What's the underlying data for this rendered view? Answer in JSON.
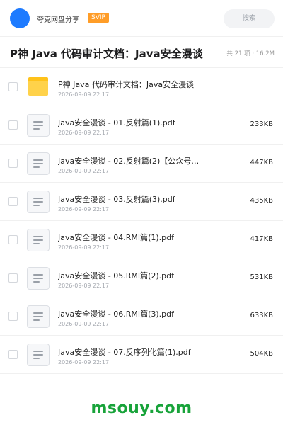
{
  "header": {
    "user_name": "夸克网盘分享",
    "badge": "SVIP",
    "search_placeholder": "搜索"
  },
  "folder": {
    "title": "P神 Java 代码审计文档：Java安全漫谈",
    "meta": "共 21 项 · 16.2M"
  },
  "items": [
    {
      "type": "folder",
      "name": "P神 Java 代码审计文档：Java安全漫谈",
      "date": "2026-09-09 22:17",
      "size": ""
    },
    {
      "type": "file",
      "name": "Java安全漫谈 - 01.反射篇(1).pdf",
      "date": "2026-09-09 22:17",
      "size": "233KB"
    },
    {
      "type": "file",
      "name": "Java安全漫谈 - 02.反射篇(2)【公众号：…",
      "date": "2026-09-09 22:17",
      "size": "447KB"
    },
    {
      "type": "file",
      "name": "Java安全漫谈 - 03.反射篇(3).pdf",
      "date": "2026-09-09 22:17",
      "size": "435KB"
    },
    {
      "type": "file",
      "name": "Java安全漫谈 - 04.RMI篇(1).pdf",
      "date": "2026-09-09 22:17",
      "size": "417KB"
    },
    {
      "type": "file",
      "name": "Java安全漫谈 - 05.RMI篇(2).pdf",
      "date": "2026-09-09 22:17",
      "size": "531KB"
    },
    {
      "type": "file",
      "name": "Java安全漫谈 - 06.RMI篇(3).pdf",
      "date": "2026-09-09 22:17",
      "size": "633KB"
    },
    {
      "type": "file",
      "name": "Java安全漫谈 - 07.反序列化篇(1).pdf",
      "date": "2026-09-09 22:17",
      "size": "504KB"
    }
  ],
  "watermark": "msouy.com",
  "colors": {
    "accent": "#1e7bff",
    "svip": "#ff9d28",
    "folder": "#ffd24a",
    "watermark": "#18a33a"
  }
}
